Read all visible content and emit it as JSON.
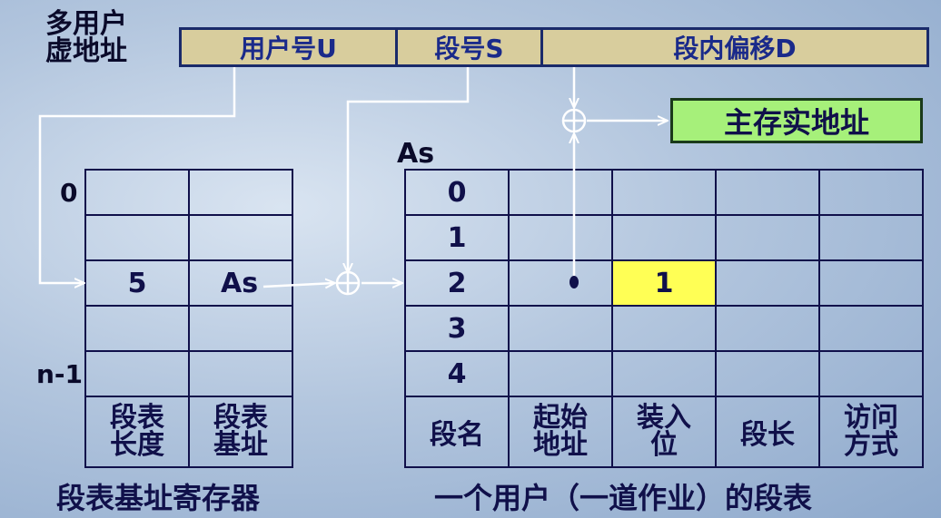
{
  "virtual_address_label": [
    "多用户",
    "虚地址"
  ],
  "address_fields": {
    "user": "用户号U",
    "segment": "段号S",
    "offset": "段内偏移D"
  },
  "physical_address": "主存实地址",
  "as_label": "As",
  "register": {
    "row_first": "0",
    "row_last": "n-1",
    "entry_length": "5",
    "entry_base": "As",
    "col_length": [
      "段表",
      "长度"
    ],
    "col_base": [
      "段表",
      "基址"
    ],
    "caption": "段表基址寄存器"
  },
  "segment_table": {
    "rows": [
      "0",
      "1",
      "2",
      "3",
      "4"
    ],
    "loaded_bit": "1",
    "col_name": "段名",
    "col_start": [
      "起始",
      "地址"
    ],
    "col_loaded": [
      "装入",
      "位"
    ],
    "col_length": "段长",
    "col_access": [
      "访问",
      "方式"
    ],
    "caption": "一个用户（一道作业）的段表",
    "highlight_color": "#ffff55"
  }
}
